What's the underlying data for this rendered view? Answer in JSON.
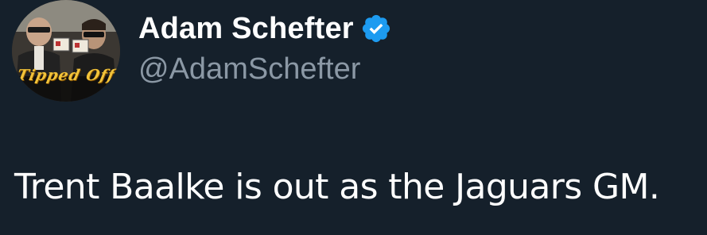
{
  "author": {
    "display_name": "Adam Schefter",
    "handle": "@AdamSchefter",
    "verified": true,
    "avatar_caption": "Tipped Off",
    "avatar_icon": "profile-photo"
  },
  "tweet": {
    "text": "Trent Baalke is out as the Jaguars GM."
  },
  "colors": {
    "background": "#15202b",
    "name": "#ffffff",
    "handle": "#8b98a5",
    "verified_badge": "#1d9bf0",
    "text": "#ffffff"
  }
}
